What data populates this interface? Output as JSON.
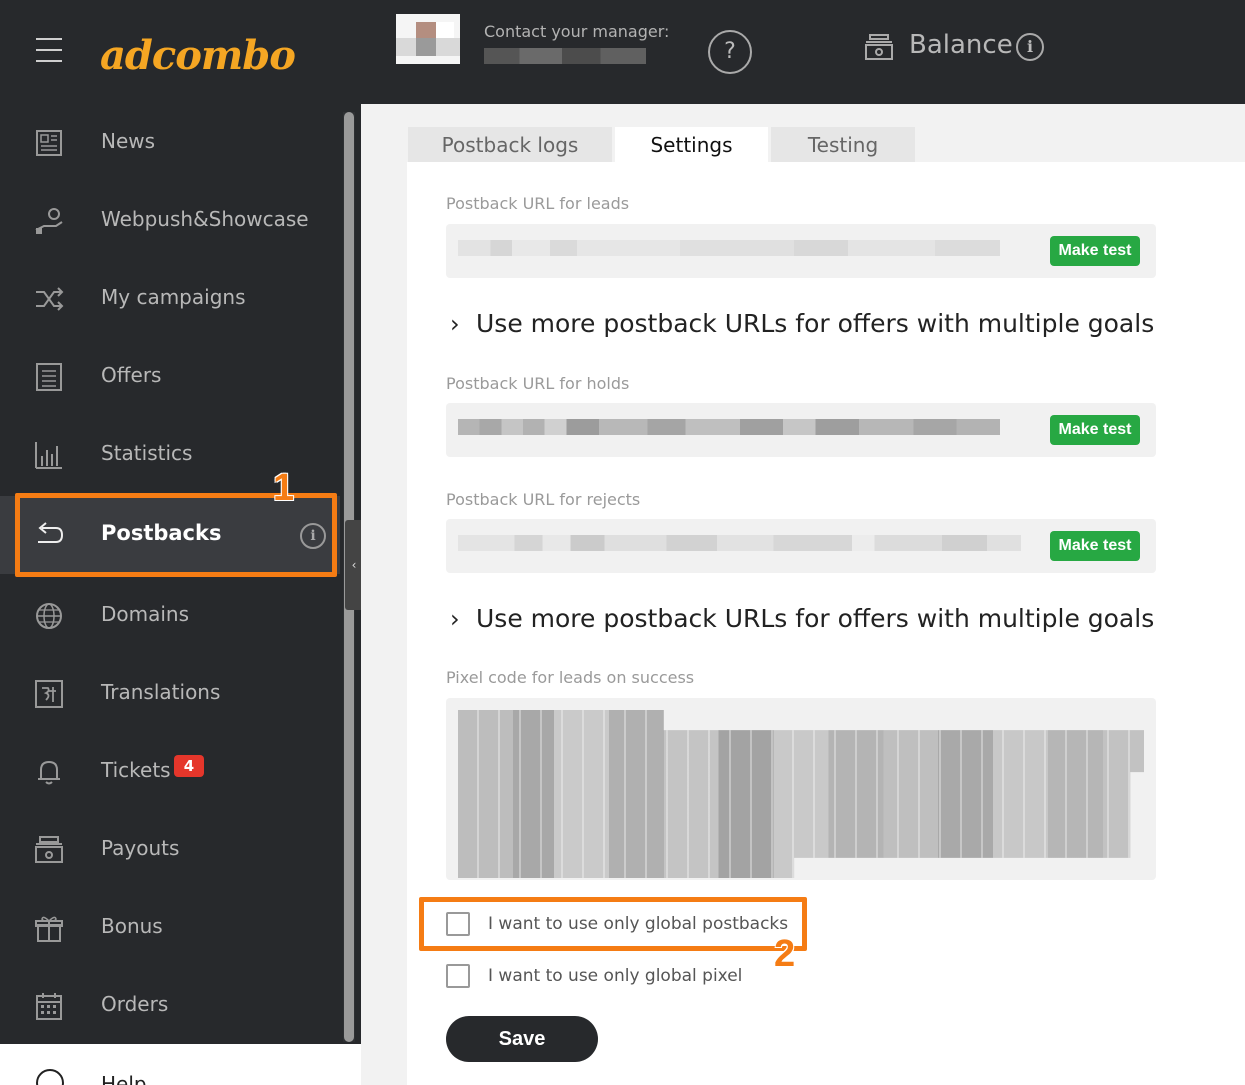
{
  "header": {
    "logo": "adcombo",
    "manager_label": "Contact your manager:",
    "help_symbol": "?",
    "balance_label": "Balance",
    "info_symbol": "i"
  },
  "sidebar": {
    "items": [
      {
        "label": "News",
        "icon": "newspaper-icon"
      },
      {
        "label": "Webpush&Showcase",
        "icon": "coin-hand-icon"
      },
      {
        "label": "My campaigns",
        "icon": "shuffle-icon"
      },
      {
        "label": "Offers",
        "icon": "list-document-icon"
      },
      {
        "label": "Statistics",
        "icon": "bar-chart-icon"
      },
      {
        "label": "Postbacks",
        "icon": "return-arrow-icon",
        "active": true
      },
      {
        "label": "Domains",
        "icon": "globe-icon"
      },
      {
        "label": "Translations",
        "icon": "translate-icon"
      },
      {
        "label": "Tickets",
        "icon": "bell-icon",
        "badge": "4"
      },
      {
        "label": "Payouts",
        "icon": "cash-register-icon"
      },
      {
        "label": "Bonus",
        "icon": "gift-icon"
      },
      {
        "label": "Orders",
        "icon": "calendar-icon"
      }
    ],
    "help_label": "Help",
    "collapse_symbol": "‹"
  },
  "tabs": [
    {
      "label": "Postback logs",
      "active": false
    },
    {
      "label": "Settings",
      "active": true
    },
    {
      "label": "Testing",
      "active": false
    }
  ],
  "settings": {
    "leads_label": "Postback URL for leads",
    "holds_label": "Postback URL for holds",
    "rejects_label": "Postback URL for rejects",
    "make_test_label": "Make test",
    "more_urls_label": "Use more postback URLs for offers with multiple goals",
    "pixel_label": "Pixel code for leads on success",
    "global_postbacks_label": "I want to use only global postbacks",
    "global_pixel_label": "I want to use only global pixel",
    "save_label": "Save"
  },
  "annotations": {
    "callout_1": "1",
    "callout_2": "2"
  },
  "colors": {
    "sidebar_bg": "#27292c",
    "accent_orange": "#f57c14",
    "logo_orange": "#f5a623",
    "button_green": "#27a843",
    "badge_red": "#e5362b"
  }
}
